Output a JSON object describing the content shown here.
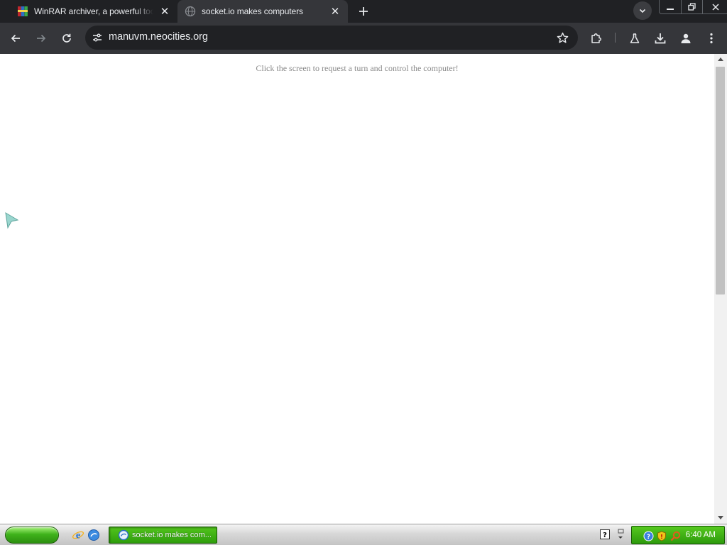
{
  "browser": {
    "tabs": [
      {
        "title": "WinRAR archiver, a powerful tool to process RAR and ZIP files",
        "active": false
      },
      {
        "title": "socket.io makes computers",
        "active": true
      }
    ],
    "url": "manuvm.neocities.org"
  },
  "page": {
    "prompt": "Click the screen to request a turn and control the computer!"
  },
  "taskbar": {
    "task_label": "socket.io makes com...",
    "clock": "6:40 AM"
  },
  "colors": {
    "tab_strip": "#202124",
    "toolbar": "#35363a",
    "xp_green": "#3fb31c"
  }
}
